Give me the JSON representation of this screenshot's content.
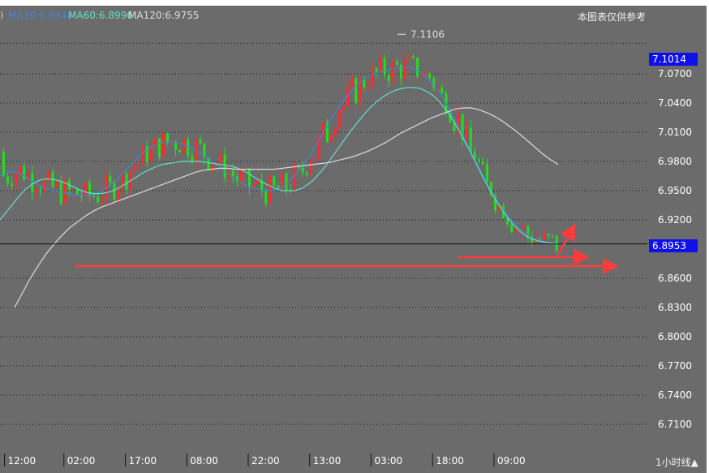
{
  "legend": {
    "ma30": "MA30:6.8944",
    "ma60": "MA60:6.8996",
    "ma120": "MA120:6.9755",
    "paren": ")"
  },
  "note": "本图表仅供参考",
  "period_label": "1小时线▲",
  "current_price": "6.8953",
  "marker_price": "7.1014",
  "peak_label": "7.1106",
  "colors": {
    "background": "#6b6b6b",
    "up": "#ff2a2a",
    "down": "#22dd22",
    "ma30": "#3f86d4",
    "ma60": "#62e0c8",
    "ma120": "#dcdcdc",
    "price_box": "#1010e8",
    "annotation": "#ff3b3b"
  },
  "chart_data": {
    "type": "candlestick",
    "ylim": [
      6.68,
      7.14
    ],
    "y_ticks": [
      "7.1014",
      "7.0700",
      "7.0400",
      "7.0100",
      "6.9800",
      "6.9500",
      "6.9200",
      "6.8953",
      "6.8600",
      "6.8300",
      "6.8000",
      "6.7700",
      "6.7400",
      "6.7100"
    ],
    "y_tick_values": [
      7.1014,
      7.07,
      7.04,
      7.01,
      6.98,
      6.95,
      6.92,
      6.8953,
      6.86,
      6.83,
      6.8,
      6.77,
      6.74,
      6.71
    ],
    "x_ticks": [
      "12:00",
      "02:00",
      "17:00",
      "08:00",
      "22:00",
      "13:00",
      "03:00",
      "18:00",
      "09:00"
    ],
    "x_tick_positions": [
      0.5,
      15,
      30,
      45,
      60,
      75,
      90,
      105,
      120
    ],
    "n_bars": 136,
    "peak": 7.1106,
    "ma30": [
      6.965,
      6.968,
      6.97,
      6.969,
      6.966,
      6.962,
      6.958,
      6.955,
      6.952,
      6.95,
      6.949,
      6.948,
      6.947,
      6.946,
      6.945,
      6.945,
      6.946,
      6.948,
      6.951,
      6.955,
      6.96,
      6.966,
      6.972,
      6.978,
      6.984,
      6.99,
      6.994,
      6.997,
      6.999,
      7.0,
      7.0,
      6.999,
      6.997,
      6.995,
      6.992,
      6.988,
      6.984,
      6.98,
      6.975,
      6.97,
      6.966,
      6.962,
      6.958,
      6.955,
      6.953,
      6.951,
      6.95,
      6.95,
      6.951,
      6.954,
      6.958,
      6.964,
      6.971,
      6.979,
      6.988,
      6.998,
      7.008,
      7.018,
      7.028,
      7.037,
      7.045,
      7.052,
      7.058,
      7.063,
      7.067,
      7.07,
      7.072,
      7.074,
      7.075,
      7.076,
      7.077,
      7.077,
      7.075,
      7.072,
      7.067,
      7.061,
      7.054,
      7.045,
      7.035,
      7.024,
      7.012,
      7.0,
      6.988,
      6.976,
      6.964,
      6.953,
      6.943,
      6.934,
      6.926,
      6.919,
      6.913,
      6.908,
      6.904,
      6.901,
      6.899,
      6.897,
      6.896,
      6.895
    ],
    "ma60": [
      6.92,
      6.928,
      6.936,
      6.944,
      6.951,
      6.956,
      6.96,
      6.962,
      6.962,
      6.961,
      6.959,
      6.956,
      6.953,
      6.95,
      6.948,
      6.947,
      6.947,
      6.948,
      6.95,
      6.953,
      6.957,
      6.961,
      6.965,
      6.969,
      6.972,
      6.975,
      6.977,
      6.978,
      6.979,
      6.98,
      6.98,
      6.98,
      6.98,
      6.979,
      6.978,
      6.977,
      6.976,
      6.975,
      6.973,
      6.97,
      6.966,
      6.962,
      6.958,
      6.955,
      6.952,
      6.95,
      6.95,
      6.95,
      6.952,
      6.956,
      6.961,
      6.968,
      6.976,
      6.985,
      6.994,
      7.003,
      7.012,
      7.02,
      7.028,
      7.035,
      7.041,
      7.046,
      7.05,
      7.053,
      7.055,
      7.056,
      7.056,
      7.055,
      7.052,
      7.048,
      7.042,
      7.034,
      7.025,
      7.014,
      7.002,
      6.99,
      6.977,
      6.964,
      6.952,
      6.941,
      6.931,
      6.922,
      6.914,
      6.908,
      6.903,
      6.9,
      6.898,
      6.897,
      6.896,
      6.896
    ],
    "ma120": [
      6.83,
      6.845,
      6.86,
      6.873,
      6.885,
      6.895,
      6.904,
      6.912,
      6.918,
      6.924,
      6.929,
      6.933,
      6.936,
      6.939,
      6.942,
      6.945,
      6.948,
      6.951,
      6.954,
      6.957,
      6.96,
      6.963,
      6.966,
      6.969,
      6.971,
      6.972,
      6.973,
      6.973,
      6.972,
      6.972,
      6.972,
      6.972,
      6.972,
      6.972,
      6.973,
      6.974,
      6.975,
      6.976,
      6.977,
      6.978,
      6.979,
      6.981,
      6.983,
      6.985,
      6.988,
      6.991,
      6.995,
      6.999,
      7.004,
      7.009,
      7.013,
      7.017,
      7.021,
      7.025,
      7.028,
      7.031,
      7.034,
      7.035,
      7.035,
      7.033,
      7.03,
      7.026,
      7.021,
      7.015,
      7.009,
      7.002,
      6.995,
      6.988,
      6.982,
      6.977
    ]
  }
}
